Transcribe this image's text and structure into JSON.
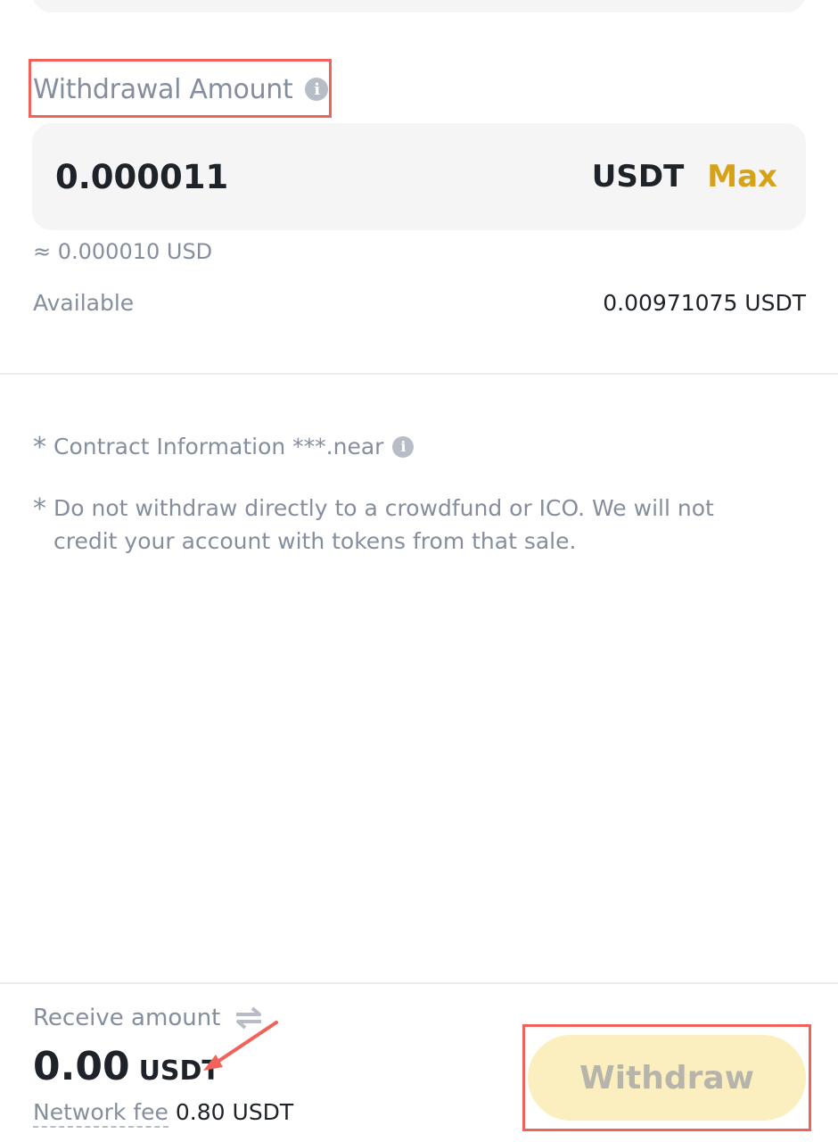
{
  "withdrawal": {
    "label": "Withdrawal Amount",
    "info_icon": "info-icon",
    "amount_value": "0.000011",
    "amount_unit": "USDT",
    "max_label": "Max",
    "approx_value": "≈ 0.000010 USD",
    "available_label": "Available",
    "available_value": "0.00971075 USDT"
  },
  "notes": [
    {
      "marker": "*",
      "text": "Contract Information ***.near",
      "has_info_icon": true
    },
    {
      "marker": "*",
      "text": "Do not withdraw directly to a crowdfund or ICO. We will not credit your account with tokens from that sale.",
      "has_info_icon": false
    }
  ],
  "footer": {
    "receive_label": "Receive amount",
    "swap_icon": "swap-arrows-icon",
    "receive_value": "0.00",
    "receive_unit": "USDT",
    "fee_label": "Network fee",
    "fee_value": "0.80 USDT",
    "withdraw_label": "Withdraw",
    "withdraw_enabled": false
  },
  "colors": {
    "accent": "#d6a21a",
    "button_disabled_bg": "#fcefbf",
    "annotation": "#f0625a",
    "muted_text": "#848e9c",
    "primary_text": "#1e2329"
  }
}
